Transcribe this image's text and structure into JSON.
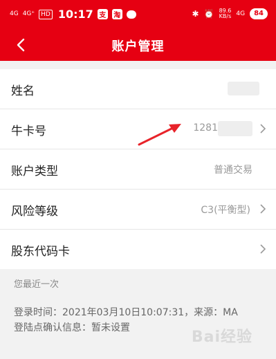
{
  "status_bar": {
    "signal_1": "4G",
    "signal_2": "4G⁺",
    "hd": "HD",
    "time": "10:17",
    "app_1": "支",
    "app_2": "淘",
    "net_speed_value": "89.6",
    "net_speed_unit": "KB/s",
    "signal_right": "4G",
    "battery": "84"
  },
  "header": {
    "title": "账户管理",
    "back_icon": "chevron-left-icon"
  },
  "rows": [
    {
      "label": "姓名",
      "value": ""
    },
    {
      "label": "牛卡号",
      "value": "1281"
    },
    {
      "label": "账户类型",
      "value": "普通交易"
    },
    {
      "label": "风险等级",
      "value": "C3(平衡型)"
    },
    {
      "label": "股东代码卡",
      "value": ""
    }
  ],
  "recent": {
    "heading": "您最近一次",
    "login_time": "登录时间：2021年03月10日10:07:31，来源：MA",
    "confirm_info": "登陆点确认信息：暂未设置"
  },
  "watermark": "Bai经验",
  "colors": {
    "brand_red": "#e60012",
    "annotation_arrow": "#e8232a"
  }
}
